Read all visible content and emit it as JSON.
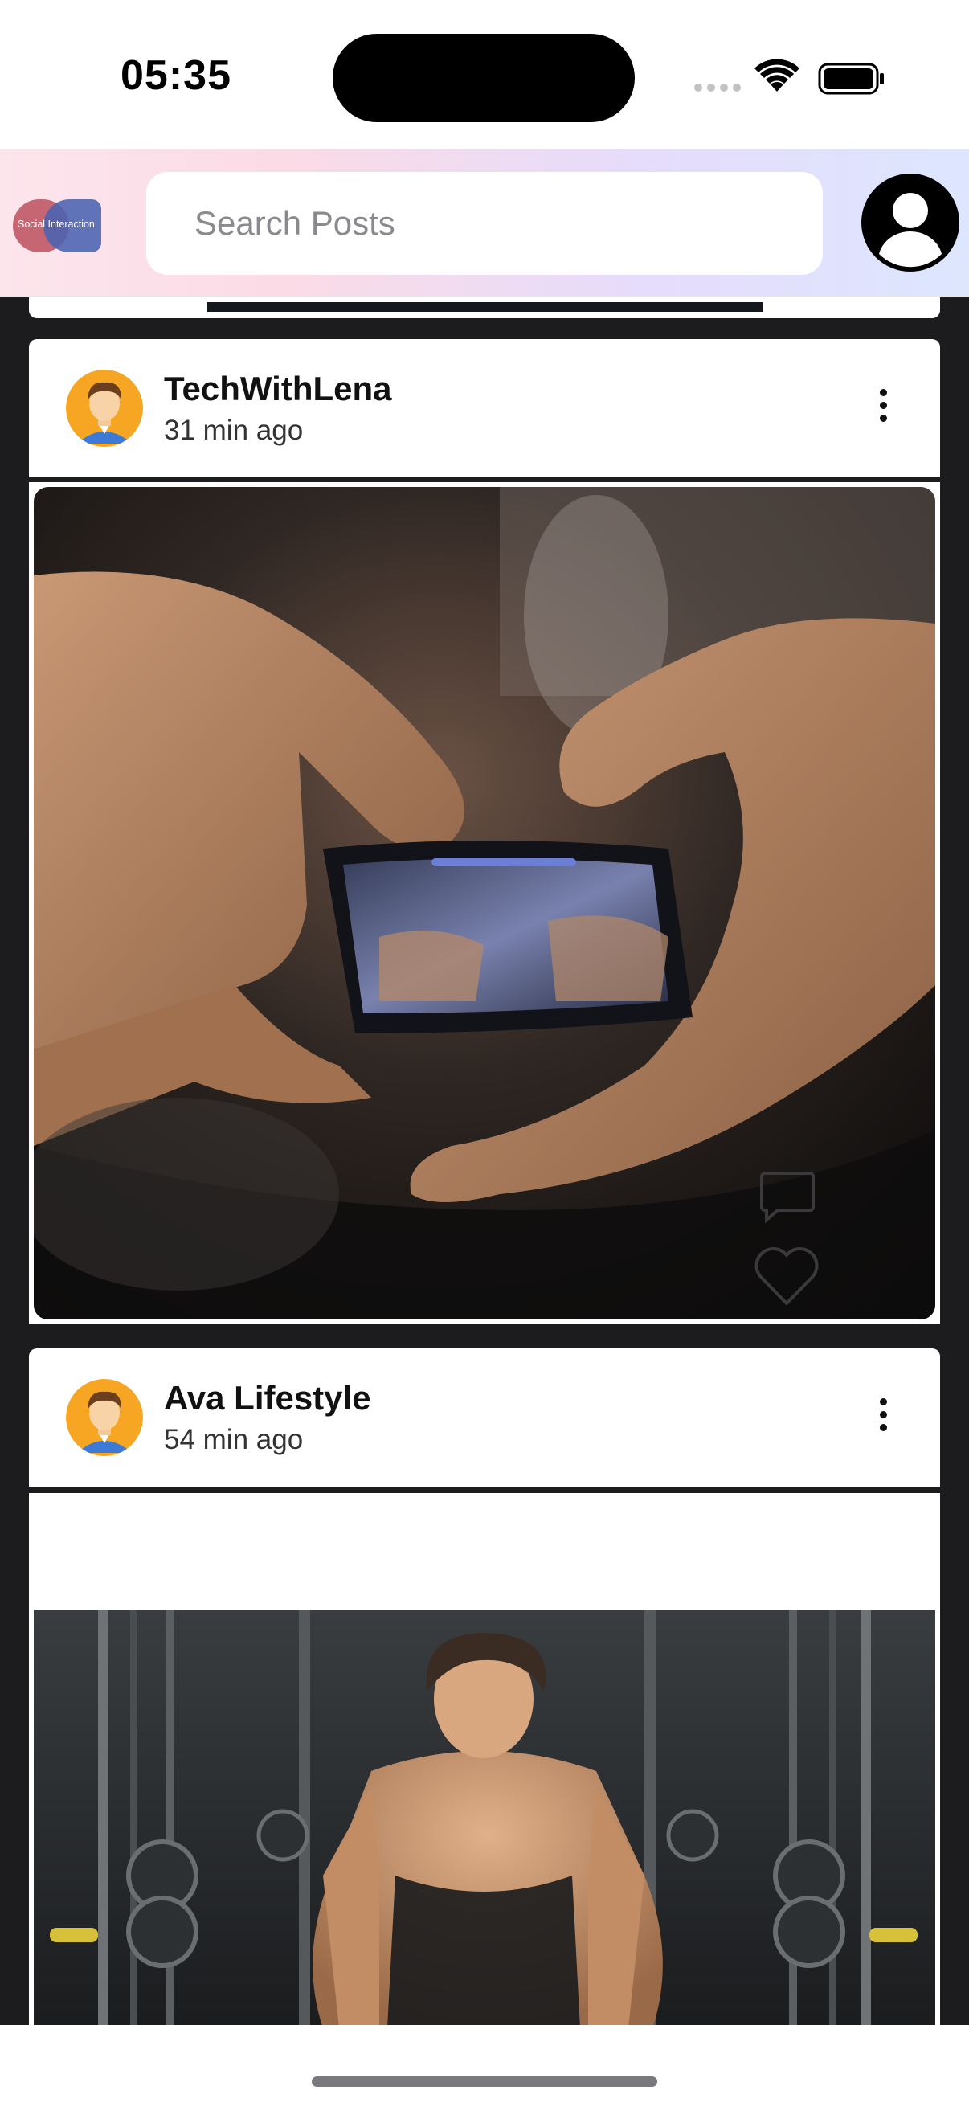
{
  "status_bar": {
    "time": "05:35",
    "icons": [
      "signal-dots-icon",
      "wifi-icon",
      "battery-icon"
    ]
  },
  "header": {
    "logo_text": "Social Interaction",
    "search": {
      "placeholder": "Search Posts",
      "value": ""
    },
    "profile_icon": "person-icon"
  },
  "posts": [
    {
      "username": "TechWithLena",
      "time_ago": "31 min ago",
      "avatar_icon": "avatar-icon",
      "media": "photo-hands-smartphone",
      "actions": [
        "comment-icon",
        "heart-icon"
      ]
    },
    {
      "username": "Ava Lifestyle",
      "time_ago": "54 min ago",
      "avatar_icon": "avatar-icon",
      "media": "photo-gym-man"
    }
  ],
  "colors": {
    "feed_background": "#1c1c1e",
    "header_gradient": [
      "#fde5ec",
      "#e6dcfb",
      "#dde6fe"
    ],
    "logo_red": "#c05866",
    "logo_blue": "#4a63b0",
    "avatar_bg": "#f6a623"
  }
}
